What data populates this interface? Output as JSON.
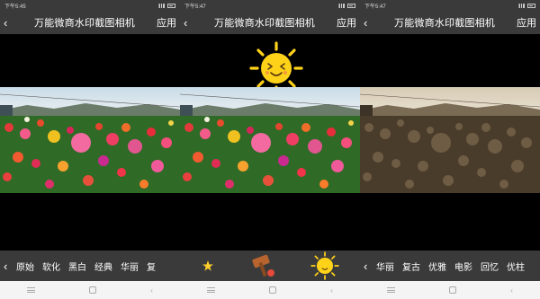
{
  "panels": [
    {
      "status": {
        "time": "下午5:45"
      },
      "appbar": {
        "back_icon": "‹",
        "title": "万能微商水印截图相机",
        "apply": "应用"
      },
      "toolbar": {
        "chevron": "‹",
        "filters": [
          "原始",
          "软化",
          "黑白",
          "经典",
          "华丽",
          "复"
        ]
      },
      "photo_style": "color"
    },
    {
      "status": {
        "time": "下午5:47"
      },
      "appbar": {
        "back_icon": "‹",
        "title": "万能微商水印截图相机",
        "apply": "应用"
      },
      "toolbar": {
        "stickers": [
          "small-star-sticker",
          "hammer-sticker",
          "sun-sticker"
        ]
      },
      "photo_style": "color",
      "sticker_on_canvas": "sun-sticker"
    },
    {
      "status": {
        "time": "下午5:47"
      },
      "appbar": {
        "back_icon": "‹",
        "title": "万能微商水印截图相机",
        "apply": "应用"
      },
      "toolbar": {
        "chevron": "‹",
        "filters": [
          "华丽",
          "复古",
          "优雅",
          "电影",
          "回忆",
          "优柱"
        ]
      },
      "photo_style": "sepia"
    }
  ],
  "colors": {
    "bar": "#3a3a3a",
    "sun": "#ffd21a"
  }
}
